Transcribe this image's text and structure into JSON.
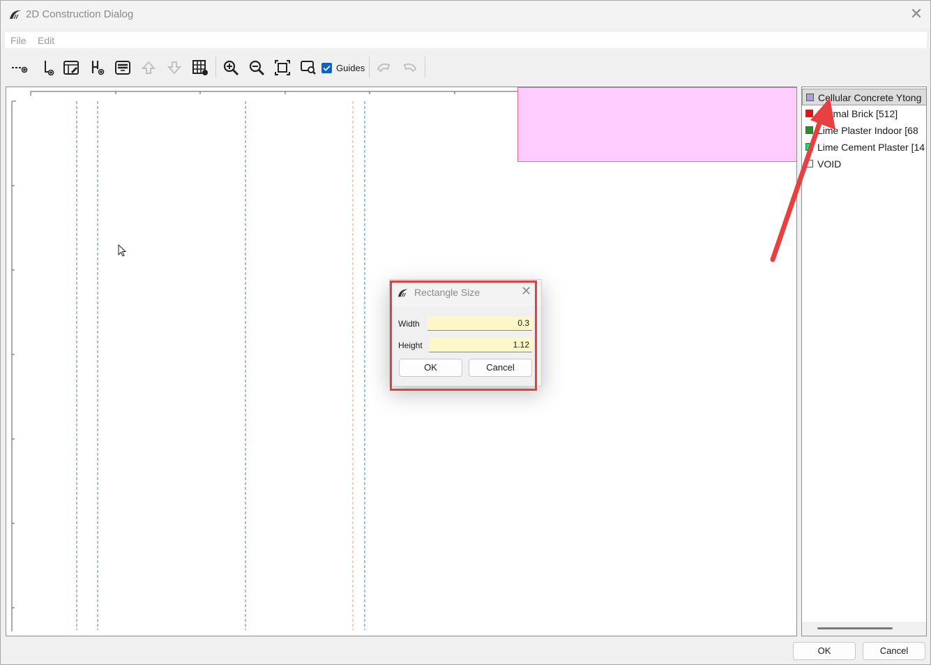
{
  "window": {
    "title": "2D Construction Dialog",
    "close_glyph": "✕",
    "logo_icon": "app-logo-icon"
  },
  "menu": {
    "items": [
      "File",
      "Edit"
    ]
  },
  "toolbar": {
    "buttons": [
      "add-horizontal-guide-icon",
      "add-vertical-guide-icon",
      "edit-table-icon",
      "add-height-guide-icon",
      "layer-icon",
      "move-up-icon",
      "move-down-icon",
      "grid-settings-icon",
      "zoom-in-icon",
      "zoom-out-icon",
      "zoom-fit-icon",
      "zoom-window-icon",
      "undo-icon",
      "redo-icon"
    ],
    "guides_label": "Guides",
    "guides_checked": true
  },
  "materials": [
    {
      "label": "Cellular Concrete Ytong",
      "color": "#a8a0e0",
      "selected": true
    },
    {
      "label": "Normal Brick [512]",
      "color": "#e81010",
      "selected": false
    },
    {
      "label": "Lime Plaster Indoor [68",
      "color": "#2e8b2e",
      "selected": false
    },
    {
      "label": "Lime Cement Plaster [14",
      "color": "#10e070",
      "selected": false
    },
    {
      "label": "VOID",
      "color": "#ffffff",
      "selected": false
    }
  ],
  "dialog": {
    "title": "Rectangle Size",
    "close_glyph": "✕",
    "width_label": "Width",
    "width_value": "0.3",
    "height_label": "Height",
    "height_value": "1.12",
    "ok_label": "OK",
    "cancel_label": "Cancel"
  },
  "footer": {
    "ok_label": "OK",
    "cancel_label": "Cancel"
  },
  "colors": {
    "accent": "#0b63c5",
    "material_fill": "#ffccff",
    "annotation": "#e04040",
    "guide_blue": "#3b7fc4",
    "guide_orange": "#e8a070"
  }
}
